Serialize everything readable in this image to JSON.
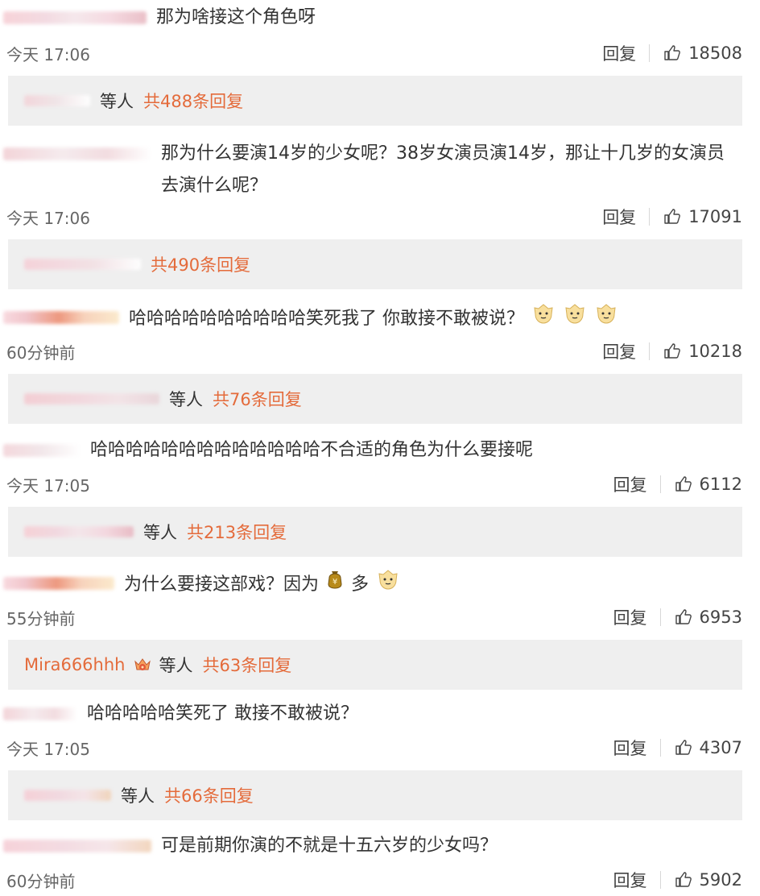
{
  "comments": [
    {
      "text": "那为啥接这个角色呀",
      "time": "今天 17:06",
      "reply_label": "回复",
      "likes": "18508",
      "reply_prefix": "等人",
      "reply_link": "共488条回复"
    },
    {
      "text": "那为什么要演14岁的少女呢？38岁女演员演14岁，那让十几岁的女演员去演什么呢？",
      "time": "今天 17:06",
      "reply_label": "回复",
      "likes": "17091",
      "reply_prefix": "",
      "reply_link": "共490条回复"
    },
    {
      "text": "哈哈哈哈哈哈哈哈哈哈笑死我了 你敢接不敢被说？",
      "time": "60分钟前",
      "reply_label": "回复",
      "likes": "10218",
      "reply_prefix": "等人",
      "reply_link": "共76条回复"
    },
    {
      "text": "哈哈哈哈哈哈哈哈哈哈哈哈哈不合适的角色为什么要接呢",
      "time": "今天 17:05",
      "reply_label": "回复",
      "likes": "6112",
      "reply_prefix": "等人",
      "reply_link": "共213条回复"
    },
    {
      "text_before": "为什么要接这部戏？因为",
      "text_after": "多",
      "time": "55分钟前",
      "reply_label": "回复",
      "likes": "6953",
      "reply_user": "Mira666hhh",
      "reply_prefix": "等人",
      "reply_link": "共63条回复"
    },
    {
      "text": "哈哈哈哈哈笑死了 敢接不敢被说？",
      "time": "今天 17:05",
      "reply_label": "回复",
      "likes": "4307",
      "reply_prefix": "等人",
      "reply_link": "共66条回复"
    },
    {
      "text": "可是前期你演的不就是十五六岁的少女吗？",
      "time": "60分钟前",
      "reply_label": "回复",
      "likes": "5902"
    }
  ],
  "icons": {
    "like": "thumbs-up-icon",
    "cat_face": "cat-face-emoji",
    "money_bag": "money-bag-emoji",
    "crown_badge": "crown-badge-icon"
  },
  "colors": {
    "accent": "#e46b3b",
    "reply_bg": "#efefef",
    "text": "#333333",
    "meta": "#666666"
  }
}
